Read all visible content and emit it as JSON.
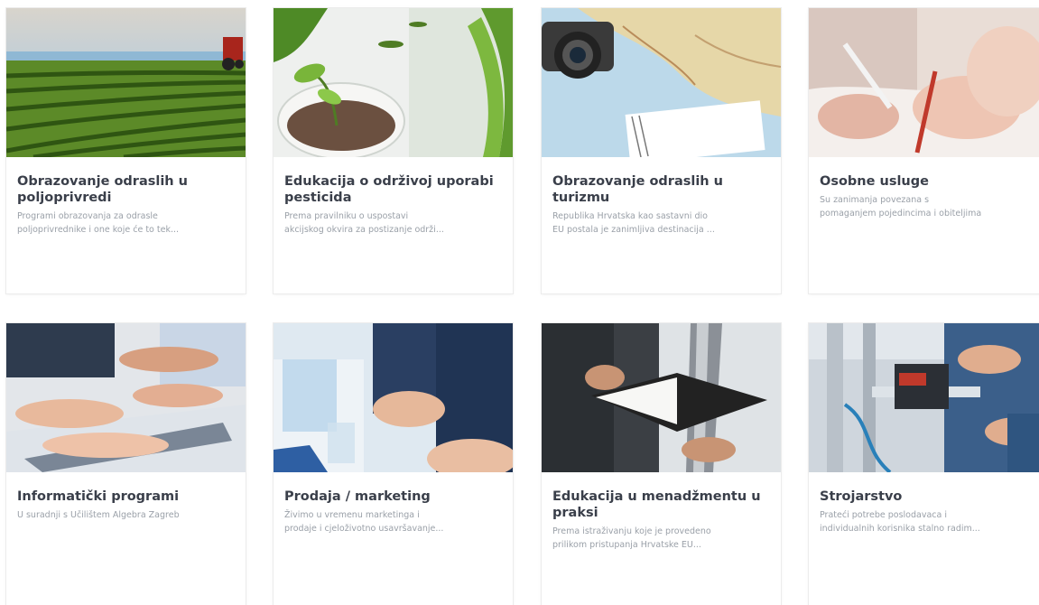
{
  "cards": [
    {
      "title_lines": [
        "Obrazovanje odraslih u",
        "poljoprivredi"
      ],
      "desc_lines": [
        "Programi obrazovanja za odrasle",
        "poljoprivrednike i one koje će to tek..."
      ],
      "image": "field-with-tractor-image"
    },
    {
      "title_lines": [
        "Edukacija o održivoj uporabi",
        "pesticida"
      ],
      "desc_lines": [
        "Prema pravilniku o uspostavi",
        "akcijskog okvira za postizanje održi..."
      ],
      "image": "plant-seedling-image"
    },
    {
      "title_lines": [
        "Obrazovanje odraslih u",
        "turizmu"
      ],
      "desc_lines": [
        "Republika Hrvatska kao sastavni dio",
        "EU postala je zanimljiva destinacija ..."
      ],
      "image": "map-and-camera-image"
    },
    {
      "title_lines": [
        "Osobne usluge"
      ],
      "desc_lines": [
        "Su zanimanja povezana s",
        "pomaganjem pojedincima i obiteljima"
      ],
      "image": "writing-hands-image"
    },
    {
      "title_lines": [
        "Informatički programi"
      ],
      "desc_lines": [
        "U suradnji s Učilištem Algebra Zagreb"
      ],
      "image": "laptop-hands-image"
    },
    {
      "title_lines": [
        "Prodaja / marketing"
      ],
      "desc_lines": [
        "Živimo u vremenu marketinga i",
        "prodaje i cjeloživotno usavršavanje..."
      ],
      "image": "business-meeting-image"
    },
    {
      "title_lines": [
        "Edukacija u menadžmentu u",
        "praksi"
      ],
      "desc_lines": [
        "Prema istraživanju koje je provedeno",
        "prilikom pristupanja Hrvatske EU..."
      ],
      "image": "open-notebook-image"
    },
    {
      "title_lines": [
        "Strojarstvo"
      ],
      "desc_lines": [
        "Prateći potrebe poslodavaca i",
        "individualnih korisnika stalno radim..."
      ],
      "image": "machinery-image"
    }
  ]
}
